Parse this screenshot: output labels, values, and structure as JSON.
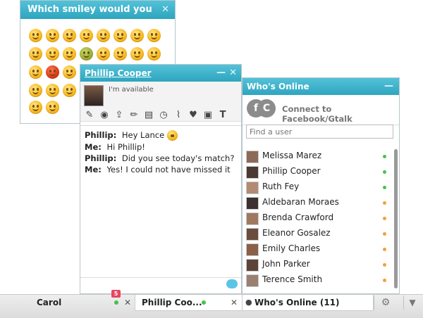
{
  "smiley_panel": {
    "title": "Which smiley would you like?",
    "close_glyph": "✕"
  },
  "chat": {
    "title": "Phillip Cooper",
    "minimize_glyph": "—",
    "close_glyph": "✕",
    "status": "I'm available",
    "toolbar_icons": [
      "brush-icon",
      "webcam-icon",
      "upload-icon",
      "pencil-icon",
      "keyboard-icon",
      "clock-icon",
      "broom-icon",
      "card-icon",
      "save-icon",
      "text-format-icon"
    ],
    "messages": [
      {
        "from": "Phillip:",
        "text": "Hey Lance"
      },
      {
        "from": "Me:",
        "text": "Hi Phillip!"
      },
      {
        "from": "Phillip:",
        "text": "Did you see today's match?"
      },
      {
        "from": "Me:",
        "text": "Yes! I could not have missed it"
      }
    ]
  },
  "online": {
    "title": "Who's Online",
    "minimize_glyph": "—",
    "connect_label": "Connect to Facebook/Gtalk",
    "search_placeholder": "Find a user",
    "users": [
      {
        "name": "Melissa Marez",
        "status": "green"
      },
      {
        "name": "Phillip Cooper",
        "status": "green"
      },
      {
        "name": "Ruth Fey",
        "status": "green"
      },
      {
        "name": "Aldebaran Moraes",
        "status": "orange"
      },
      {
        "name": "Brenda Crawford",
        "status": "orange"
      },
      {
        "name": "Eleanor Gosalez",
        "status": "orange"
      },
      {
        "name": "Emily Charles",
        "status": "orange"
      },
      {
        "name": "John Parker",
        "status": "orange"
      },
      {
        "name": "Terence Smith",
        "status": "orange"
      }
    ]
  },
  "bottombar": {
    "carol_tab": "Carol",
    "carol_badge": "5",
    "phillip_tab": "Phillip Coo...",
    "online_tab": "Who's Online (11)",
    "close_glyph": "✕"
  },
  "colors": {
    "accent": "#2fa5bf",
    "status_green": "#47c24a",
    "status_orange": "#f0a23a",
    "badge": "#e8455e"
  }
}
